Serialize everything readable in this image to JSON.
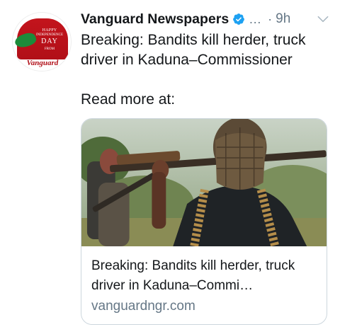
{
  "tweet": {
    "display_name": "Vanguard Newspapers",
    "truncation": "…",
    "separator": "·",
    "timestamp": "9h",
    "text_line": "Breaking: Bandits kill herder, truck driver in Kaduna–Commissioner",
    "read_more": "Read more at:"
  },
  "avatar": {
    "badge_line1": "HAPPY",
    "badge_line2": "INDEPENDENCE",
    "badge_line3": "DAY",
    "badge_line4": "FROM",
    "logo_text": "Vanguard"
  },
  "card": {
    "title": "Breaking: Bandits kill herder, truck driver in Kaduna–Commi…",
    "domain": "vanguardngr.com"
  },
  "icons": {
    "verified": "verified-badge-icon",
    "menu": "chevron-down-icon"
  },
  "colors": {
    "text_primary": "#14171a",
    "text_secondary": "#657786",
    "verified_blue": "#1da1f2",
    "card_border": "#ccd6dd",
    "brand_red": "#b10f18",
    "brand_green": "#1c8b3a"
  }
}
